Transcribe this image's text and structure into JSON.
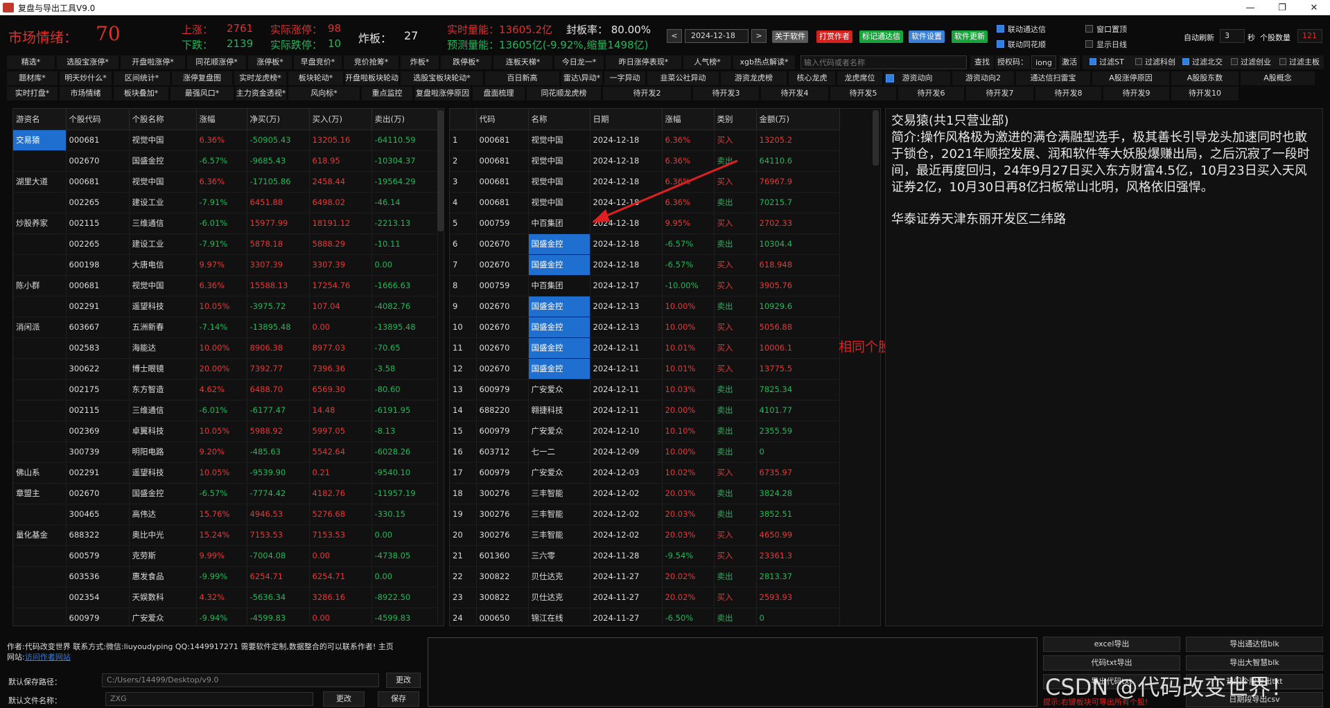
{
  "window": {
    "title": "复盘与导出工具V9.0",
    "min": "—",
    "max": "❐",
    "close": "✕"
  },
  "header": {
    "sentiment_label": "市场情绪：",
    "sentiment_value": "70",
    "up_label": "上涨：",
    "up_value": "2761",
    "limit_up_label": "实际涨停：",
    "limit_up_value": "98",
    "down_label": "下跌：",
    "down_value": "2139",
    "limit_down_label": "实际跌停：",
    "limit_down_value": "10",
    "broken_label": "炸板：",
    "broken_value": "27",
    "volume_text": "实时量能：13605.2亿",
    "seal_rate_text": "封板率：  80.00%",
    "forecast_text": "预测量能：13605亿(-9.92%,缩量1498亿)",
    "date": "2024-12-18",
    "prev": "<",
    "next": ">",
    "btn_about": "关于软件",
    "btn_reward": "打赏作者",
    "btn_mark": "标记通达信",
    "btn_settings": "软件设置",
    "btn_update": "软件更新",
    "chk_tdx": "联动通达信",
    "chk_ths": "联动同花顺",
    "chk_top": "窗口置顶",
    "chk_day": "显示日线",
    "auto_refresh_label": "自动刷新",
    "auto_refresh_value": "3",
    "seconds": "秒",
    "stock_count_label": "个股数量",
    "stock_count_value": "121"
  },
  "toolbar": {
    "row1": [
      "精选*",
      "选股宝涨停*",
      "开盘啦涨停*",
      "同花顺涨停*",
      "涨停板*",
      "早盘竞价*",
      "竞价抢筹*",
      "炸板*",
      "跌停板*",
      "连板天梯*",
      "今日龙一*",
      "昨日涨停表现*",
      "人气榜*",
      "xgb热点解读*"
    ],
    "search_placeholder": "输入代码或者名称",
    "search_btn": "查找",
    "auth_label": "授权码：",
    "auth_value": "iong",
    "activate": "激活",
    "filters": [
      "过滤ST",
      "过滤科创",
      "过滤北交",
      "过滤创业",
      "过滤主板"
    ],
    "row2": [
      "题材库*",
      "明天炒什么*",
      "区间统计*",
      "涨停复盘图",
      "实时龙虎榜*",
      "板块轮动*",
      "开盘啦板块轮动",
      "选股宝板块轮动*",
      "百日新高",
      "雷达\\异动*",
      "一字异动",
      "韭菜公社异动",
      "游资龙虎榜",
      "核心龙虎",
      "龙虎席位",
      "游资动向",
      "游资动向2",
      "通达信扫雷宝",
      "A股涨停原因",
      "A股股东数",
      "A股概念"
    ],
    "row3": [
      "实时打盘*",
      "市场情绪",
      "板块叠加*",
      "最强风口*",
      "主力资金透视*",
      "风向标*",
      "重点监控",
      "复盘啦涨停原因",
      "盘面梳理",
      "同花顺龙虎榜",
      "待开发2",
      "待开发3",
      "待开发4",
      "待开发5",
      "待开发6",
      "待开发7",
      "待开发8",
      "待开发9",
      "待开发10"
    ]
  },
  "left_table": {
    "headers": [
      "游资名",
      "个股代码",
      "个股名称",
      "涨幅",
      "净买(万)",
      "买入(万)",
      "卖出(万)"
    ],
    "rows": [
      [
        "交易猿",
        "000681",
        "视觉中国",
        "6.36%",
        "-50905.43",
        "13205.16",
        "-64110.59"
      ],
      [
        "",
        "002670",
        "国盛金控",
        "-6.57%",
        "-9685.43",
        "618.95",
        "-10304.37"
      ],
      [
        "湖里大道",
        "000681",
        "视觉中国",
        "6.36%",
        "-17105.86",
        "2458.44",
        "-19564.29"
      ],
      [
        "",
        "002265",
        "建设工业",
        "-7.91%",
        "6451.88",
        "6498.02",
        "-46.14"
      ],
      [
        "炒股养家",
        "002115",
        "三维通信",
        "-6.01%",
        "15977.99",
        "18191.12",
        "-2213.13"
      ],
      [
        "",
        "002265",
        "建设工业",
        "-7.91%",
        "5878.18",
        "5888.29",
        "-10.11"
      ],
      [
        "",
        "600198",
        "大唐电信",
        "9.97%",
        "3307.39",
        "3307.39",
        "0.00"
      ],
      [
        "陈小群",
        "000681",
        "视觉中国",
        "6.36%",
        "15588.13",
        "17254.76",
        "-1666.63"
      ],
      [
        "",
        "002291",
        "遥望科技",
        "10.05%",
        "-3975.72",
        "107.04",
        "-4082.76"
      ],
      [
        "消闲派",
        "603667",
        "五洲新春",
        "-7.14%",
        "-13895.48",
        "0.00",
        "-13895.48"
      ],
      [
        "",
        "002583",
        "海能达",
        "10.00%",
        "8906.38",
        "8977.03",
        "-70.65"
      ],
      [
        "",
        "300622",
        "博士眼镜",
        "20.00%",
        "7392.77",
        "7396.36",
        "-3.58"
      ],
      [
        "",
        "002175",
        "东方智造",
        "4.62%",
        "6488.70",
        "6569.30",
        "-80.60"
      ],
      [
        "",
        "002115",
        "三维通信",
        "-6.01%",
        "-6177.47",
        "14.48",
        "-6191.95"
      ],
      [
        "",
        "002369",
        "卓翼科技",
        "10.05%",
        "5988.92",
        "5997.05",
        "-8.13"
      ],
      [
        "",
        "300739",
        "明阳电路",
        "9.20%",
        "-485.63",
        "5542.64",
        "-6028.26"
      ],
      [
        "佛山系",
        "002291",
        "遥望科技",
        "10.05%",
        "-9539.90",
        "0.21",
        "-9540.10"
      ],
      [
        "章盟主",
        "002670",
        "国盛金控",
        "-6.57%",
        "-7774.42",
        "4182.76",
        "-11957.19"
      ],
      [
        "",
        "300465",
        "高伟达",
        "15.76%",
        "4946.53",
        "5276.68",
        "-330.15"
      ],
      [
        "量化基金",
        "688322",
        "奥比中光",
        "15.24%",
        "7153.53",
        "7153.53",
        "0.00"
      ],
      [
        "",
        "600579",
        "克劳斯",
        "9.99%",
        "-7004.08",
        "0.00",
        "-4738.05"
      ],
      [
        "",
        "603536",
        "惠发食品",
        "-9.99%",
        "6254.71",
        "6254.71",
        "0.00"
      ],
      [
        "",
        "002354",
        "天娱数科",
        "4.32%",
        "-5636.34",
        "3286.16",
        "-8922.50"
      ],
      [
        "",
        "600979",
        "广安爱众",
        "-9.94%",
        "-4599.83",
        "0.00",
        "-4599.83"
      ]
    ]
  },
  "right_table": {
    "headers": [
      "",
      "代码",
      "名称",
      "日期",
      "涨幅",
      "类别",
      "金额(万)"
    ],
    "rows": [
      [
        "1",
        "000681",
        "视觉中国",
        "2024-12-18",
        "6.36%",
        "买入",
        "13205.2"
      ],
      [
        "2",
        "000681",
        "视觉中国",
        "2024-12-18",
        "6.36%",
        "卖出",
        "64110.6"
      ],
      [
        "3",
        "000681",
        "视觉中国",
        "2024-12-18",
        "6.36%",
        "买入",
        "76967.9"
      ],
      [
        "4",
        "000681",
        "视觉中国",
        "2024-12-18",
        "6.36%",
        "卖出",
        "70215.7"
      ],
      [
        "5",
        "000759",
        "中百集团",
        "2024-12-18",
        "9.95%",
        "买入",
        "2702.33"
      ],
      [
        "6",
        "002670",
        "国盛金控",
        "2024-12-18",
        "-6.57%",
        "卖出",
        "10304.4"
      ],
      [
        "7",
        "002670",
        "国盛金控",
        "2024-12-18",
        "-6.57%",
        "买入",
        "618.948"
      ],
      [
        "8",
        "000759",
        "中百集团",
        "2024-12-17",
        "-10.00%",
        "买入",
        "3905.76"
      ],
      [
        "9",
        "002670",
        "国盛金控",
        "2024-12-13",
        "10.00%",
        "卖出",
        "10929.6"
      ],
      [
        "10",
        "002670",
        "国盛金控",
        "2024-12-13",
        "10.00%",
        "买入",
        "5056.88"
      ],
      [
        "11",
        "002670",
        "国盛金控",
        "2024-12-11",
        "10.01%",
        "买入",
        "10006.1"
      ],
      [
        "12",
        "002670",
        "国盛金控",
        "2024-12-11",
        "10.01%",
        "买入",
        "13775.5"
      ],
      [
        "13",
        "600979",
        "广安爱众",
        "2024-12-11",
        "10.03%",
        "卖出",
        "7825.34"
      ],
      [
        "14",
        "688220",
        "翱捷科技",
        "2024-12-11",
        "20.00%",
        "卖出",
        "4101.77"
      ],
      [
        "15",
        "600979",
        "广安爱众",
        "2024-12-10",
        "10.10%",
        "卖出",
        "2355.59"
      ],
      [
        "16",
        "603712",
        "七一二",
        "2024-12-09",
        "10.00%",
        "卖出",
        "0"
      ],
      [
        "17",
        "600979",
        "广安爱众",
        "2024-12-03",
        "10.02%",
        "买入",
        "6735.97"
      ],
      [
        "18",
        "300276",
        "三丰智能",
        "2024-12-02",
        "20.03%",
        "卖出",
        "3824.28"
      ],
      [
        "19",
        "300276",
        "三丰智能",
        "2024-12-02",
        "20.03%",
        "卖出",
        "3852.51"
      ],
      [
        "20",
        "300276",
        "三丰智能",
        "2024-12-02",
        "20.03%",
        "买入",
        "4650.99"
      ],
      [
        "21",
        "601360",
        "三六零",
        "2024-11-28",
        "-9.54%",
        "买入",
        "23361.3"
      ],
      [
        "22",
        "300822",
        "贝仕达克",
        "2024-11-27",
        "20.02%",
        "卖出",
        "2813.37"
      ],
      [
        "23",
        "300822",
        "贝仕达克",
        "2024-11-27",
        "20.02%",
        "买入",
        "2593.93"
      ],
      [
        "24",
        "000650",
        "锦江在线",
        "2024-11-27",
        "-6.50%",
        "卖出",
        "0"
      ]
    ],
    "highlight_name": "国盛金控"
  },
  "annotation": {
    "text": "相同个股高亮显示",
    "color": "#e02020"
  },
  "description": {
    "title": "交易猿(共1只营业部)",
    "intro": "简介:操作风格极为激进的满仓满融型选手，极其善长引导龙头加速同时也敢于锁仓，2021年顺控发展、润和软件等大妖股爆赚出局，之后沉寂了一段时间，最近再度回归，24年9月27日买入东方财富4.5亿，10月23日买入天风证券2亿，10月30日再8亿扫板常山北明，风格依旧强悍。",
    "branch": "华泰证券天津东丽开发区二纬路"
  },
  "footer": {
    "author_text": "作者:代码改变世界 联系方式:微信:liuyoudyping QQ:1449917271 需要软件定制,数据整合的可以联系作者! 主页",
    "site_label": "网站:",
    "site_link": "访问作者网站",
    "save_path_label": "默认保存路径：",
    "save_path_value": "C:/Users/14499/Desktop/v9.0",
    "change": "更改",
    "file_name_label": "默认文件名称：",
    "file_name_value": "ZXG",
    "change2": "更改",
    "save": "保存",
    "btn_excel": "excel导出",
    "btn_tdx_blk": "导出通达信blk",
    "btn_txt": "代码txt导出",
    "btn_dzh_blk": "导出大智慧blk",
    "btn_txt2": "导出代码txt",
    "btn_hot": "热门个股导出txt",
    "btn_csv": "日期段导出csv",
    "hint": "提示:右键板块可导出所有个股!",
    "watermark": "CSDN @代码改变世界！"
  },
  "colors": {
    "accent": "#1f6fd0",
    "up": "#e23a3a",
    "down": "#23b85a"
  }
}
